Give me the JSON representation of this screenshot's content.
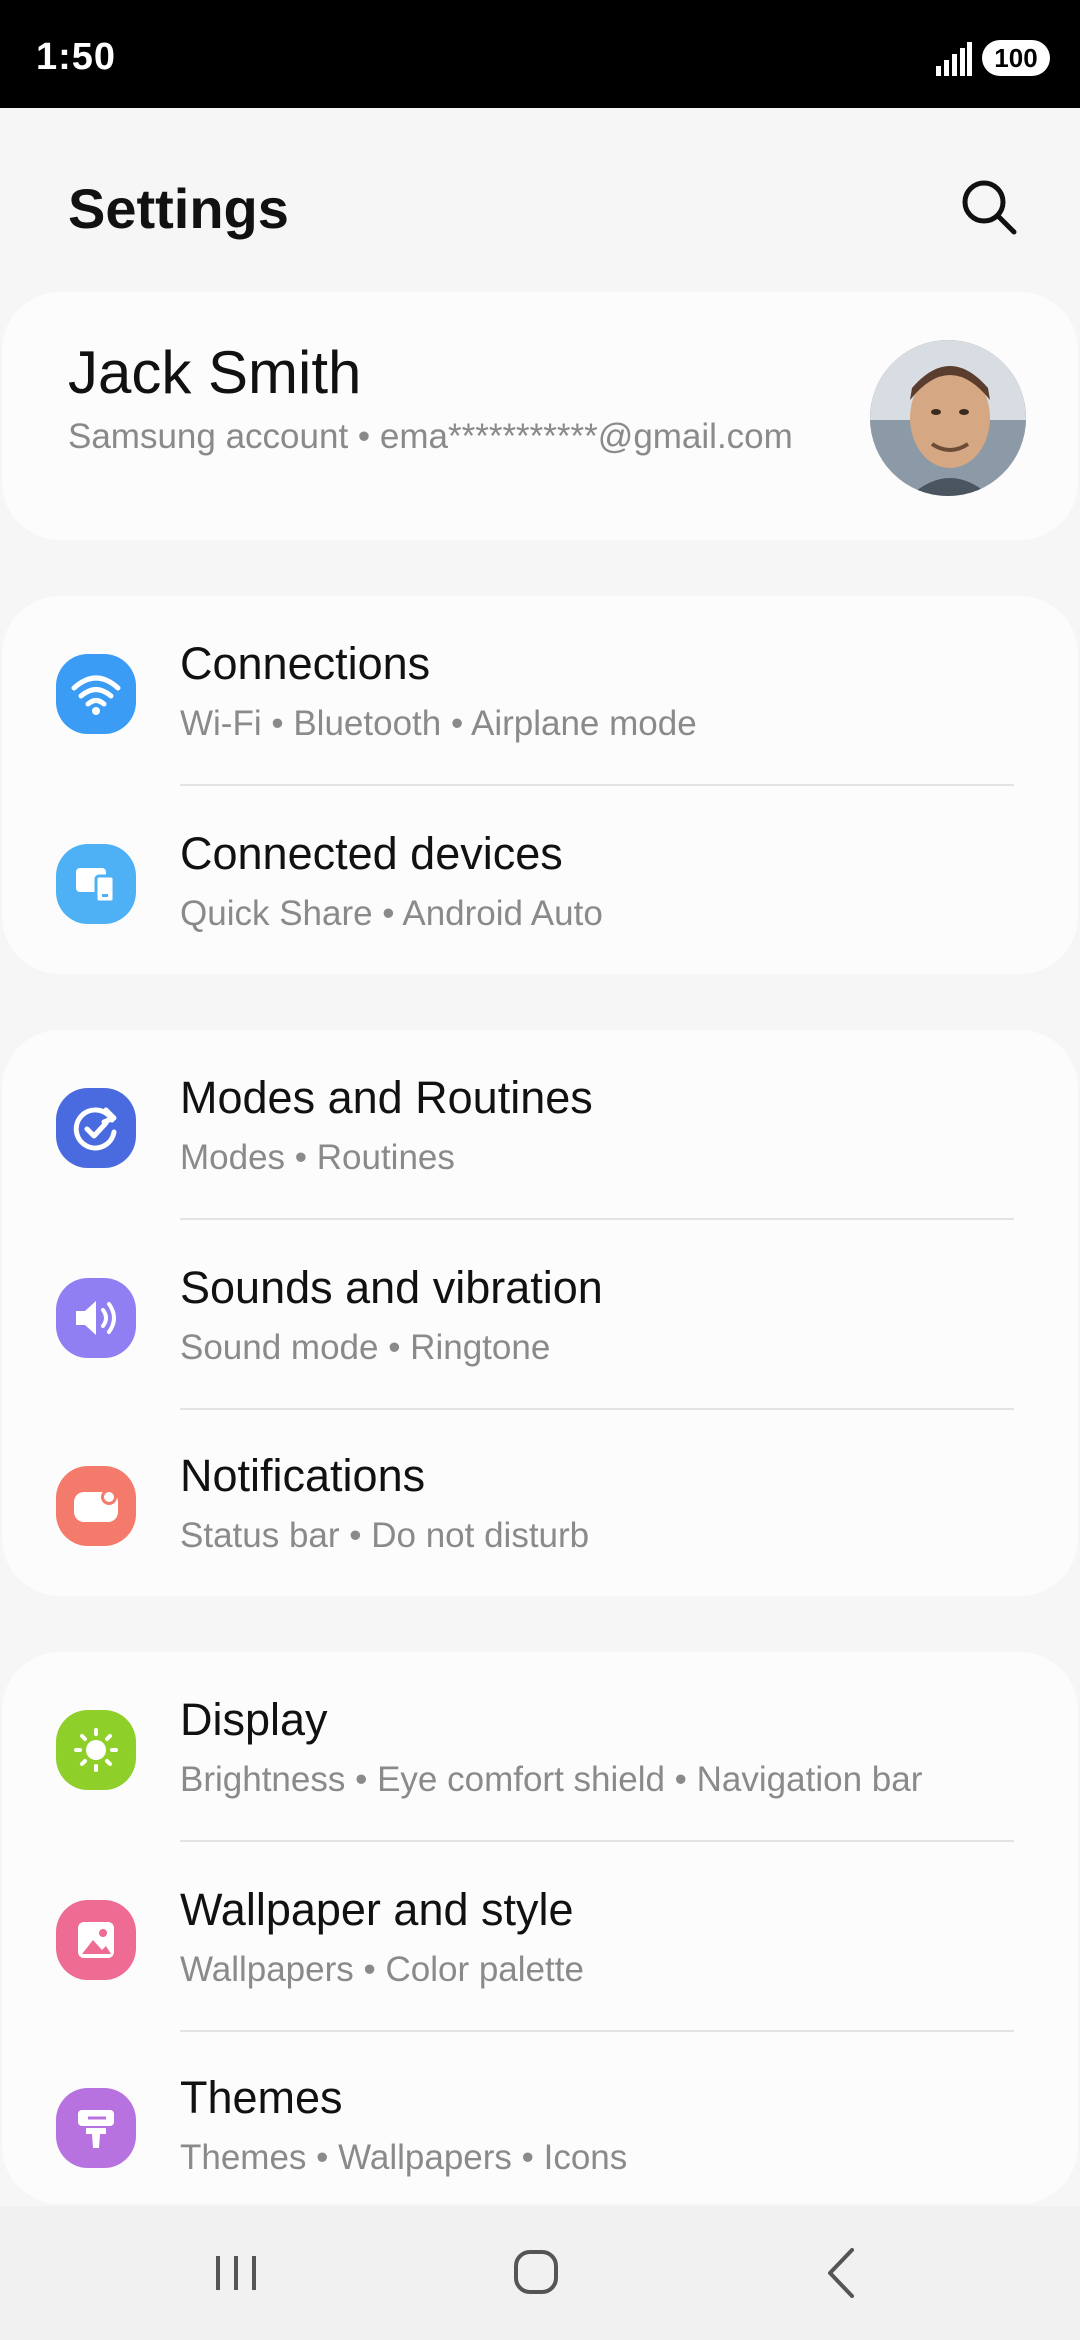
{
  "status": {
    "time": "1:50",
    "battery": "100"
  },
  "header": {
    "title": "Settings"
  },
  "account": {
    "name": "Jack Smith",
    "subtitle": "Samsung account  •  ema***********@gmail.com"
  },
  "groups": [
    {
      "items": [
        {
          "title": "Connections",
          "sub": "Wi-Fi  •  Bluetooth  •  Airplane mode",
          "icon": "wifi-icon",
          "color": "#3a9cf4"
        },
        {
          "title": "Connected devices",
          "sub": "Quick Share  •  Android Auto",
          "icon": "devices-icon",
          "color": "#4fb1f5"
        }
      ]
    },
    {
      "items": [
        {
          "title": "Modes and Routines",
          "sub": "Modes  •  Routines",
          "icon": "routines-icon",
          "color": "#4a6be0"
        },
        {
          "title": "Sounds and vibration",
          "sub": "Sound mode  •  Ringtone",
          "icon": "speaker-icon",
          "color": "#8f7ff2"
        },
        {
          "title": "Notifications",
          "sub": "Status bar  •  Do not disturb",
          "icon": "notification-icon",
          "color": "#f47b6b"
        }
      ]
    },
    {
      "items": [
        {
          "title": "Display",
          "sub": "Brightness  •  Eye comfort shield  •  Navigation bar",
          "icon": "sun-icon",
          "color": "#8ecf2a"
        },
        {
          "title": "Wallpaper and style",
          "sub": "Wallpapers  •  Color palette",
          "icon": "wallpaper-icon",
          "color": "#ee6b93"
        },
        {
          "title": "Themes",
          "sub": "Themes  •  Wallpapers  •  Icons",
          "icon": "themes-icon",
          "color": "#b872e0"
        }
      ]
    }
  ]
}
